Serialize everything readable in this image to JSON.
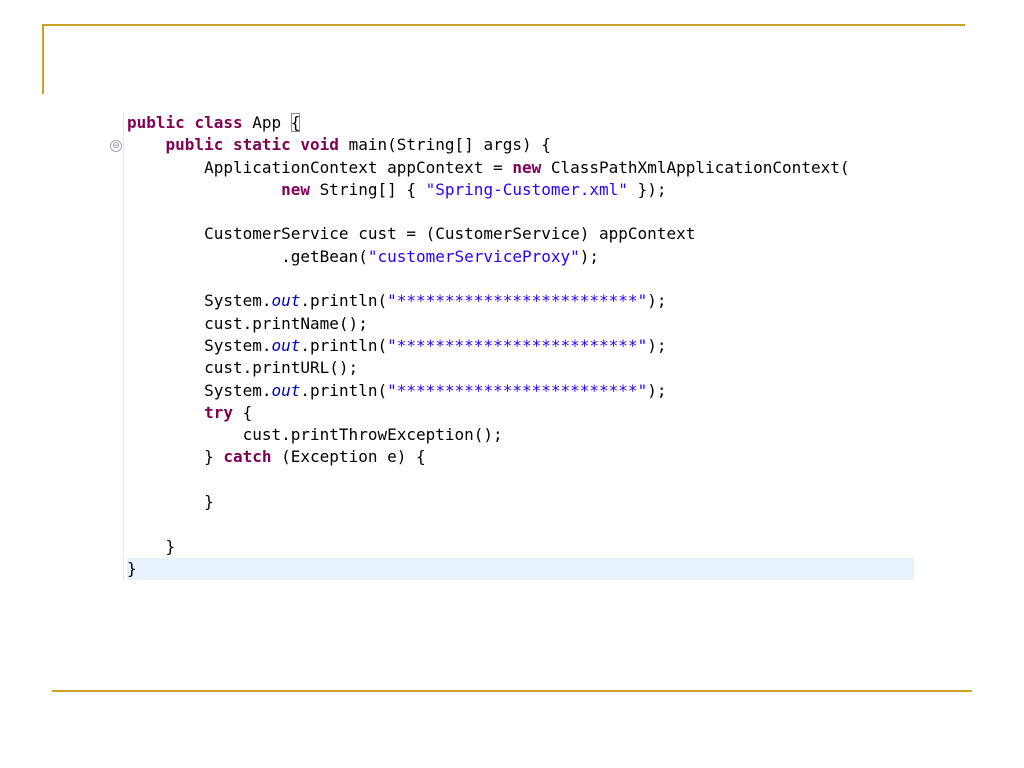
{
  "code": {
    "l1": {
      "kw1": "public",
      "kw2": "class",
      "name": "App",
      "brace": "{"
    },
    "l2": {
      "kw1": "public",
      "kw2": "static",
      "kw3": "void",
      "rest": "main(String[] args) {"
    },
    "l3": {
      "pre": "ApplicationContext appContext = ",
      "kw": "new",
      "post": "ClassPathXmlApplicationContext("
    },
    "l4": {
      "kw": "new",
      "pre": "String[] { ",
      "str": "\"Spring-Customer.xml\"",
      "post": " });"
    },
    "l6": {
      "text": "CustomerService cust = (CustomerService) appContext"
    },
    "l7": {
      "pre": ".getBean(",
      "str": "\"customerServiceProxy\"",
      "post": ");"
    },
    "l9": {
      "pre": "System.",
      "field": "out",
      "mid": ".println(",
      "str": "\"*************************\"",
      "post": ");"
    },
    "l10": {
      "text": "cust.printName();"
    },
    "l11": {
      "pre": "System.",
      "field": "out",
      "mid": ".println(",
      "str": "\"*************************\"",
      "post": ");"
    },
    "l12": {
      "text": "cust.printURL();"
    },
    "l13": {
      "pre": "System.",
      "field": "out",
      "mid": ".println(",
      "str": "\"*************************\"",
      "post": ");"
    },
    "l14": {
      "kw": "try",
      "post": " {"
    },
    "l15": {
      "text": "cust.printThrowException();"
    },
    "l16": {
      "pre": "} ",
      "kw": "catch",
      "post": " (Exception e) {"
    },
    "l18": {
      "text": "}"
    },
    "l20": {
      "text": "}"
    },
    "l21": {
      "text": "}"
    }
  },
  "gutter": {
    "fold_icon": "collapse-icon",
    "fold_glyph": "⊖"
  },
  "colors": {
    "keyword": "#7f0055",
    "string": "#2a00ff",
    "static_field": "#0000c0",
    "current_line": "#e8f2fe",
    "frame_accent": "#c9a227"
  }
}
